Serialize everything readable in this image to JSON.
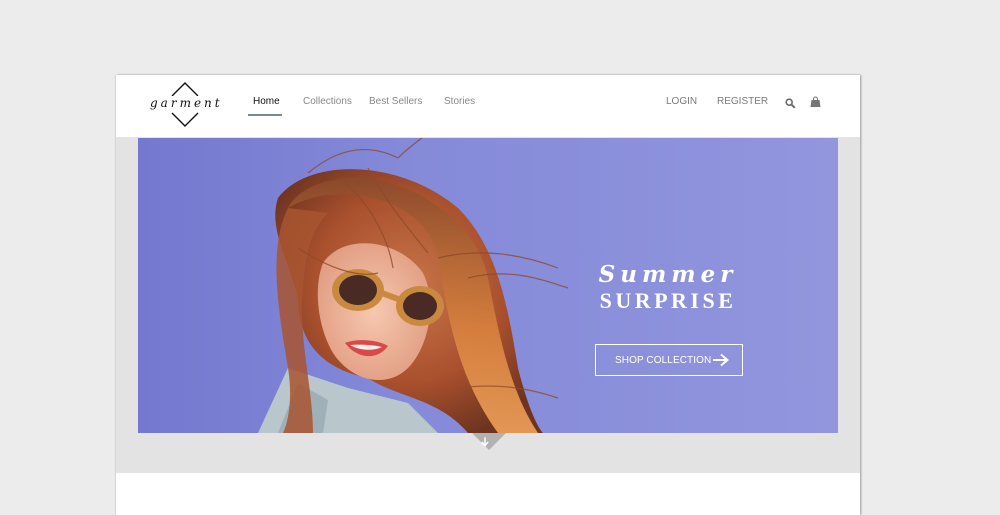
{
  "brand": {
    "logo_text": "garment",
    "logo_icon": "diamond-outline-icon"
  },
  "nav": {
    "items": [
      {
        "label": "Home",
        "active": true
      },
      {
        "label": "Collections",
        "active": false
      },
      {
        "label": "Best Sellers",
        "active": false
      },
      {
        "label": "Stories",
        "active": false
      }
    ],
    "login_label": "LOGIN",
    "register_label": "REGISTER",
    "search_icon": "search-icon",
    "cart_icon": "shopping-bag-icon"
  },
  "hero": {
    "script_text": "Summer",
    "title_text": "SURPRISE",
    "cta_label": "SHOP COLLECTION",
    "cta_icon": "arrow-right-icon",
    "image_description": "Woman with wind-blown red hair wearing wooden sunglasses against a periwinkle background",
    "scroll_icon": "arrow-down-icon"
  },
  "colors": {
    "hero_background": "#868bd9",
    "page_background": "#ececec",
    "band_background": "#e4e3e4",
    "nav_active_underline": "#7a8a94",
    "nav_text": "#888888",
    "nav_active_text": "#111111"
  }
}
